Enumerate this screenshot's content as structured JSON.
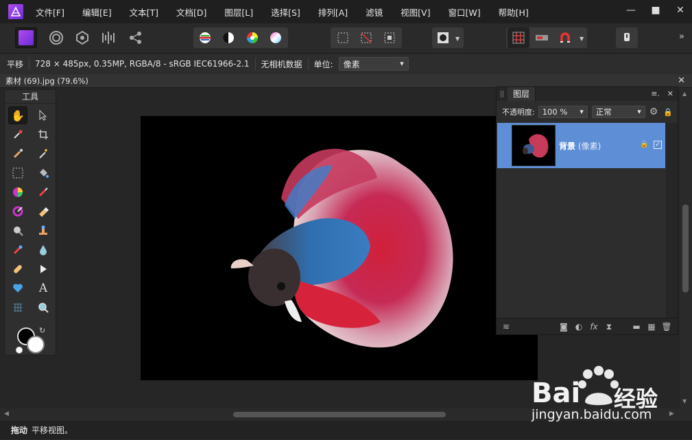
{
  "menu": [
    "文件[F]",
    "编辑[E]",
    "文本[T]",
    "文档[D]",
    "图层[L]",
    "选择[S]",
    "排列[A]",
    "滤镜",
    "视图[V]",
    "窗口[W]",
    "帮助[H]"
  ],
  "window_buttons": [
    "—",
    "■",
    "✕"
  ],
  "toolbar": {
    "overflow": "»"
  },
  "context": {
    "tool_name": "平移",
    "image_info": "728 × 485px, 0.35MP, RGBA/8 - sRGB IEC61966-2.1",
    "camera_data": "无相机数据",
    "unit_label": "单位:",
    "unit_value": "像素"
  },
  "document": {
    "tab_title": "素材 (69).jpg (79.6%)",
    "close": "✕"
  },
  "tools": {
    "title": "工具"
  },
  "layers": {
    "tab": "图层",
    "opacity_label": "不透明度:",
    "opacity_value": "100 %",
    "blend_value": "正常",
    "layer_name": "背景",
    "layer_type": "(像素)",
    "fx": "fx"
  },
  "status": {
    "bold": "拖动",
    "text": "平移视图。"
  },
  "watermark": {
    "brand": "Bai",
    "brand2": "经验",
    "url": "jingyan.baidu.com"
  },
  "colors": {
    "accent": "#5e8ed6",
    "menubar": "#1f1f1f",
    "canvas_bg": "#000000"
  }
}
